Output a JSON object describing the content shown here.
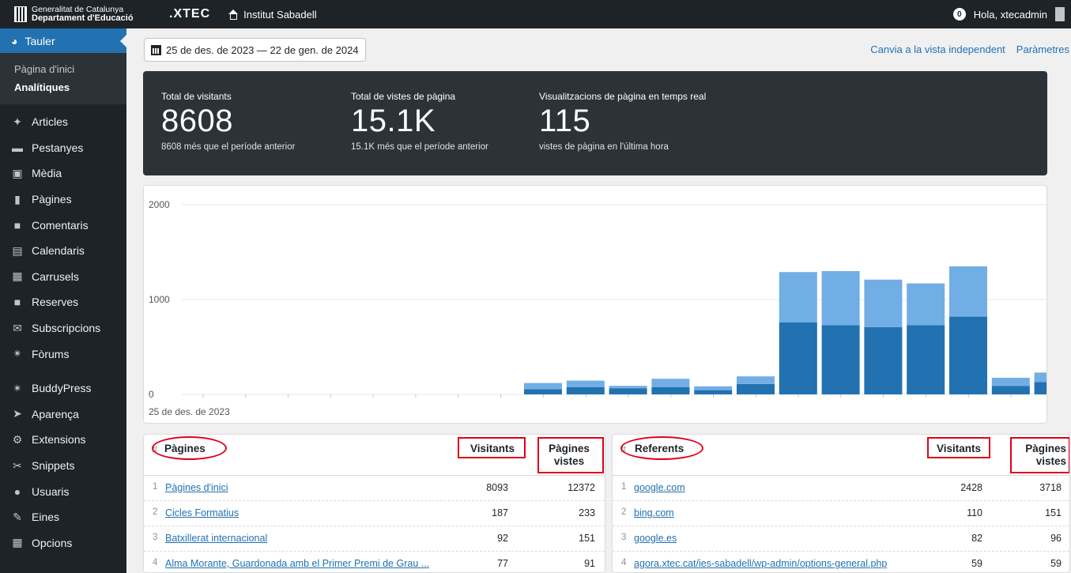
{
  "topbar": {
    "gencat_line1": "Generalitat de Catalunya",
    "gencat_line2": "Departament d'Educació",
    "xtec": ".XTEC",
    "site_name": "Institut Sabadell",
    "notifications": "0",
    "greeting": "Hola, xtecadmin"
  },
  "sidebar": {
    "active": "Tauler",
    "submenu": [
      "Pàgina d'inici",
      "Analítiques"
    ],
    "items": [
      "Articles",
      "Pestanyes",
      "Mèdia",
      "Pàgines",
      "Comentaris",
      "Calendaris",
      "Carrusels",
      "Reserves",
      "Subscripcions",
      "Fòrums",
      "BuddyPress",
      "Aparença",
      "Extensions",
      "Snippets",
      "Usuaris",
      "Eines",
      "Opcions"
    ],
    "icons": [
      "pin-icon",
      "folder-icon",
      "media-icon",
      "pages-icon",
      "comment-icon",
      "calendar-icon",
      "carousel-icon",
      "reserves-icon",
      "mail-icon",
      "forum-icon",
      "buddypress-icon",
      "appearance-icon",
      "plugin-icon",
      "snippet-icon",
      "user-icon",
      "tools-icon",
      "settings-icon"
    ]
  },
  "toolbar": {
    "date_range": "25 de des. de 2023 — 22 de gen. de 2024",
    "link_independent": "Canvia a la vista independent",
    "link_params": "Paràmetres"
  },
  "stats": [
    {
      "label": "Total de visitants",
      "value": "8608",
      "sub": "8608 més que el període anterior"
    },
    {
      "label": "Total de vistes de pàgina",
      "value": "15.1K",
      "sub": "15.1K més que el període anterior"
    },
    {
      "label": "Visualitzacions de pàgina en temps real",
      "value": "115",
      "sub": "vistes de pàgina en l'última hora"
    }
  ],
  "chart_data": {
    "type": "bar",
    "stacked": true,
    "ylim": [
      0,
      2000
    ],
    "yticks": [
      "0",
      "1000",
      "2000"
    ],
    "x_label_first": "25 de des. de 2023",
    "days": 29,
    "series": [
      {
        "color": "#2271b1",
        "values": [
          0,
          0,
          0,
          0,
          0,
          0,
          0,
          0,
          0,
          55,
          75,
          65,
          75,
          45,
          110,
          760,
          730,
          710,
          730,
          820,
          90,
          130,
          null,
          null,
          null,
          null,
          null,
          null,
          null
        ]
      },
      {
        "color": "#72aee6",
        "values": [
          0,
          0,
          0,
          0,
          0,
          0,
          0,
          0,
          0,
          65,
          70,
          25,
          90,
          40,
          80,
          530,
          570,
          500,
          440,
          530,
          85,
          100,
          null,
          null,
          null,
          null,
          null,
          null,
          null
        ]
      }
    ],
    "first_data_index": 9
  },
  "pages_table": {
    "hash": "#",
    "title": "Pàgines",
    "col1": "Visitants",
    "col2_line1": "Pàgines",
    "col2_line2": "vistes",
    "rows": [
      {
        "i": "1",
        "name": "Pàgines d'inici",
        "v": "8093",
        "pv": "12372"
      },
      {
        "i": "2",
        "name": "Cicles Formatius",
        "v": "187",
        "pv": "233"
      },
      {
        "i": "3",
        "name": "Batxillerat internacional",
        "v": "92",
        "pv": "151"
      },
      {
        "i": "4",
        "name": "Alma Morante, Guardonada amb el Primer Premi de Grau ...",
        "v": "77",
        "pv": "91"
      }
    ]
  },
  "referrers_table": {
    "hash": "#",
    "title": "Referents",
    "col1": "Visitants",
    "col2_line1": "Pàgines",
    "col2_line2": "vistes",
    "rows": [
      {
        "i": "1",
        "name": "google.com",
        "v": "2428",
        "pv": "3718"
      },
      {
        "i": "2",
        "name": "bing.com",
        "v": "110",
        "pv": "151"
      },
      {
        "i": "3",
        "name": "google.es",
        "v": "82",
        "pv": "96"
      },
      {
        "i": "4",
        "name": "agora.xtec.cat/ies-sabadell/wp-admin/options-general.php",
        "v": "59",
        "pv": "59"
      }
    ]
  },
  "colors": {
    "accent": "#2271b1",
    "highlight": "#e0001b",
    "dark": "#1d2327"
  }
}
